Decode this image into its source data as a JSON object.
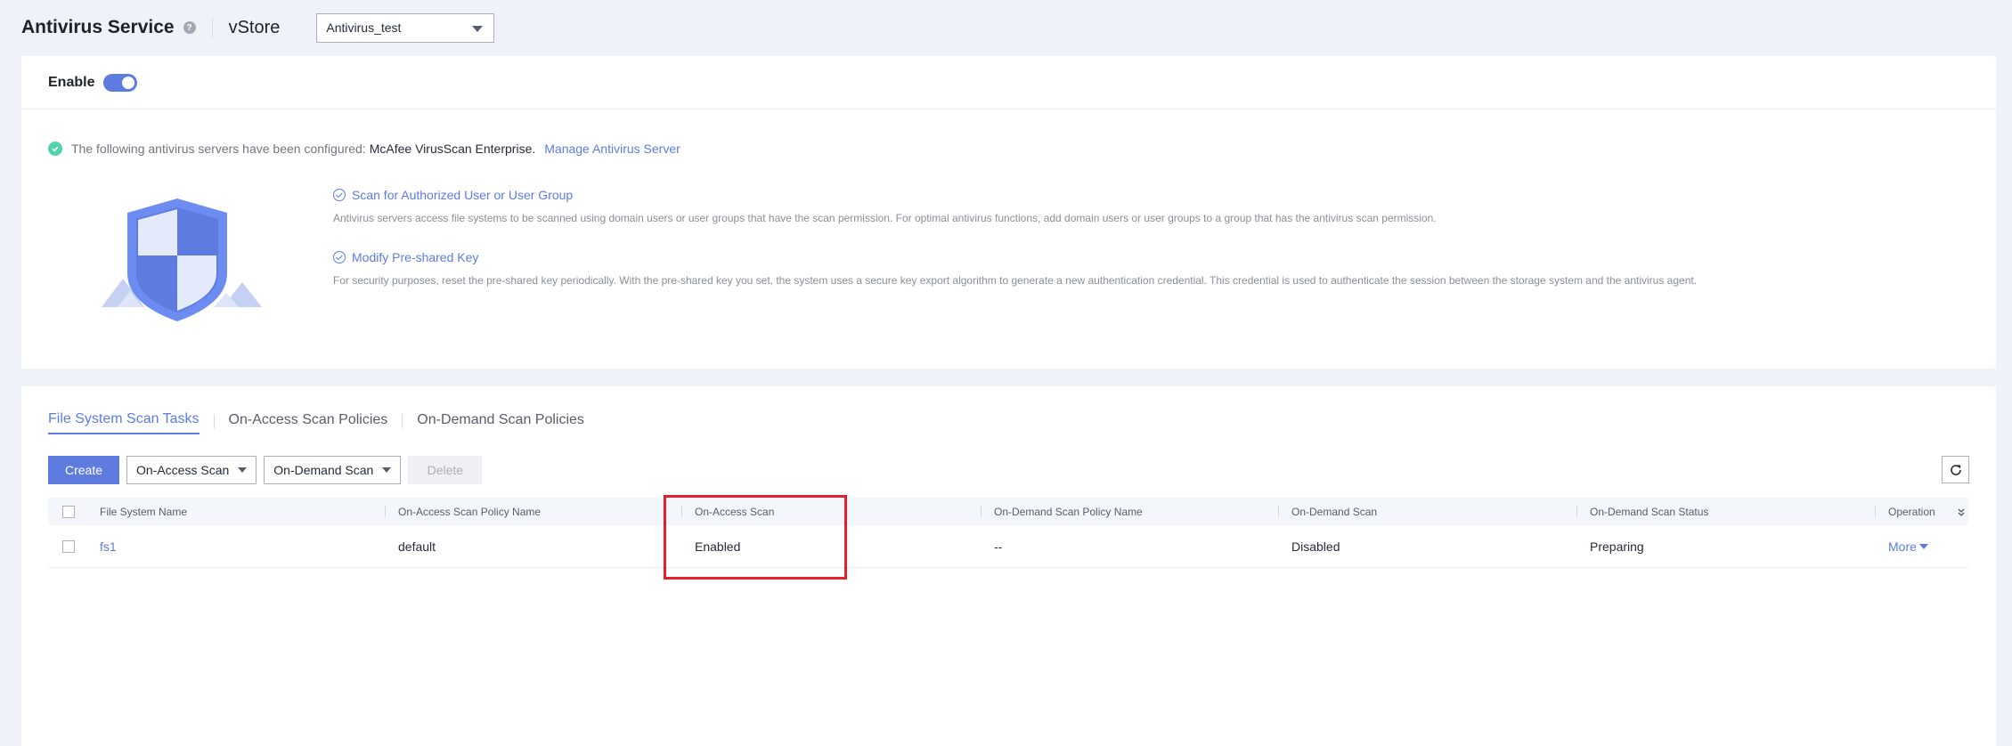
{
  "header": {
    "title": "Antivirus Service",
    "help_icon": "?",
    "vstore_label": "vStore",
    "vstore_value": "Antivirus_test"
  },
  "enable": {
    "label": "Enable",
    "state": "on"
  },
  "server_status": {
    "prefix": "The following antivirus servers have been configured:",
    "server": "McAfee VirusScan Enterprise",
    "dot": ".",
    "manage_link": "Manage Antivirus Server"
  },
  "info": [
    {
      "title": "Scan for Authorized User or User Group",
      "desc": "Antivirus servers access file systems to be scanned using domain users or user groups that have the scan permission. For optimal antivirus functions, add domain users or user groups to a group that has the antivirus scan permission."
    },
    {
      "title": "Modify Pre-shared Key",
      "desc": "For security purposes, reset the pre-shared key periodically. With the pre-shared key you set, the system uses a secure key export algorithm to generate a new authentication credential. This credential is used to authenticate the session between the storage system and the antivirus agent."
    }
  ],
  "tabs": [
    {
      "label": "File System Scan Tasks",
      "active": true
    },
    {
      "label": "On-Access Scan Policies",
      "active": false
    },
    {
      "label": "On-Demand Scan Policies",
      "active": false
    }
  ],
  "toolbar": {
    "create": "Create",
    "on_access": "On-Access Scan",
    "on_demand": "On-Demand Scan",
    "delete": "Delete"
  },
  "table": {
    "columns": [
      "File System Name",
      "On-Access Scan Policy Name",
      "On-Access Scan",
      "On-Demand Scan Policy Name",
      "On-Demand Scan",
      "On-Demand Scan Status",
      "Operation"
    ],
    "rows": [
      {
        "name": "fs1",
        "on_access_policy": "default",
        "on_access": "Enabled",
        "on_demand_policy": "--",
        "on_demand": "Disabled",
        "status": "Preparing",
        "operation": "More"
      }
    ]
  },
  "colors": {
    "accent": "#5e7ce0",
    "success": "#50d4ab",
    "highlight": "#e5202e"
  }
}
